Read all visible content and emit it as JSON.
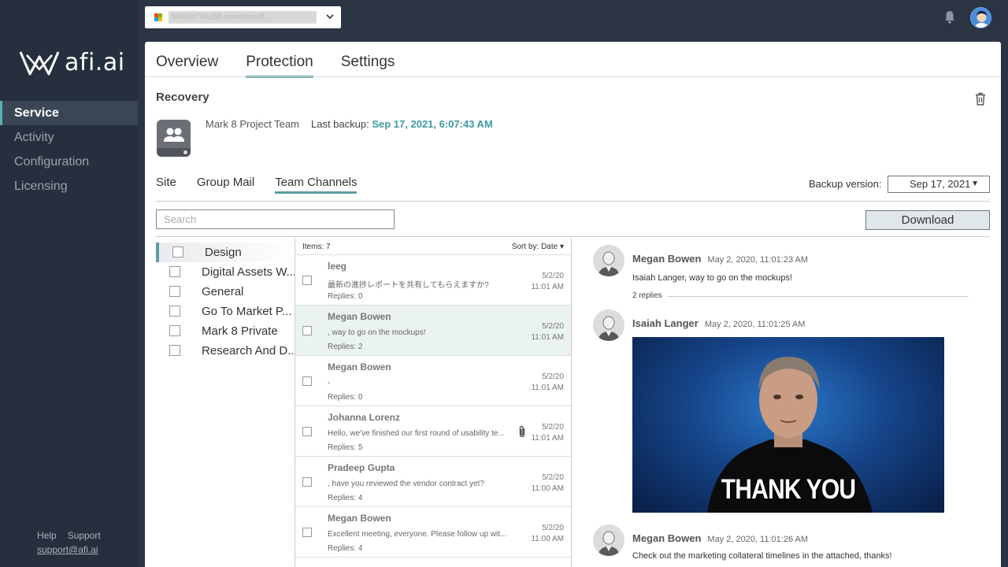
{
  "brand": {
    "name": "afi.ai"
  },
  "nav": {
    "items": [
      {
        "label": "Service"
      },
      {
        "label": "Activity"
      },
      {
        "label": "Configuration"
      },
      {
        "label": "Licensing"
      }
    ]
  },
  "footer": {
    "help": "Help",
    "support": "Support",
    "email": "support@afi.ai"
  },
  "topbar": {
    "tenant": "M365x796256.onmicrosoft..."
  },
  "tabs": [
    "Overview",
    "Protection",
    "Settings"
  ],
  "recovery": {
    "title": "Recovery",
    "group_name": "Mark 8 Project Team",
    "backup_label": "Last backup:",
    "backup_value": "Sep 17, 2021, 6:07:43 AM"
  },
  "subtabs": [
    "Site",
    "Group Mail",
    "Team Channels"
  ],
  "backup_version": {
    "label": "Backup version:",
    "value": "Sep 17, 2021"
  },
  "search": {
    "placeholder": "Search"
  },
  "download_label": "Download",
  "channels": [
    "Design",
    "Digital Assets W...",
    "General",
    "Go To Market P...",
    "Mark 8 Private",
    "Research And D..."
  ],
  "list": {
    "items_count": "Items: 7",
    "sort_label": "Sort by: Date",
    "messages": [
      {
        "author": "leeg",
        "preview": "最新の進捗レポートを共有してもらえますか?",
        "replies": "Replies: 0",
        "date": "5/2/20",
        "time": "11:01 AM",
        "attachment": false
      },
      {
        "author": "Megan Bowen",
        "preview": ", way to go on the mockups!",
        "replies": "Replies: 2",
        "date": "5/2/20",
        "time": "11:01 AM",
        "attachment": false
      },
      {
        "author": "Megan Bowen",
        "preview": "-",
        "replies": "Replies: 0",
        "date": "5/2/20",
        "time": "11:01 AM",
        "attachment": false
      },
      {
        "author": "Johanna Lorenz",
        "preview": "Hello, we've finished our first round of usability te...",
        "replies": "Replies: 5",
        "date": "5/2/20",
        "time": "11:01 AM",
        "attachment": true
      },
      {
        "author": "Pradeep Gupta",
        "preview": ", have you reviewed the vendor contract yet?",
        "replies": "Replies: 4",
        "date": "5/2/20",
        "time": "11:00 AM",
        "attachment": false
      },
      {
        "author": "Megan Bowen",
        "preview": "Excellent meeting, everyone. Please follow up wit...",
        "replies": "Replies: 4",
        "date": "5/2/20",
        "time": "11:00 AM",
        "attachment": false
      }
    ]
  },
  "thread": {
    "messages": [
      {
        "author": "Megan Bowen",
        "time": "May 2, 2020, 11:01:23 AM",
        "text": "Isaiah Langer, way to go on the mockups!",
        "replies": "2 replies"
      },
      {
        "author": "Isaiah Langer",
        "time": "May 2, 2020, 11:01:25 AM",
        "image_caption": "THANK YOU"
      },
      {
        "author": "Megan Bowen",
        "time": "May 2, 2020, 11:01:26 AM",
        "text": "Check out the marketing collateral timelines in the attached, thanks!"
      }
    ]
  }
}
